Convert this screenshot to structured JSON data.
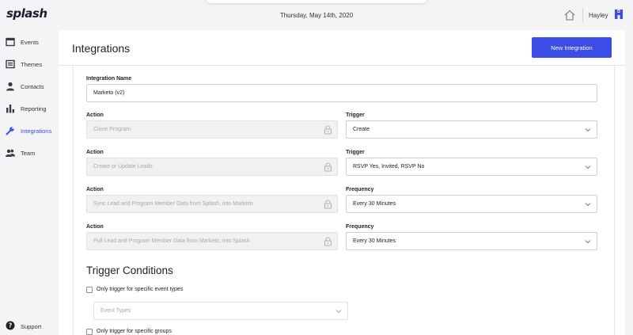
{
  "app": {
    "logo": "splash"
  },
  "header": {
    "date": "Thursday, May 14th, 2020",
    "user": "Hayley"
  },
  "sidebar": {
    "items": [
      {
        "label": "Events",
        "icon": "calendar-icon"
      },
      {
        "label": "Themes",
        "icon": "theme-icon"
      },
      {
        "label": "Contacts",
        "icon": "person-icon"
      },
      {
        "label": "Reporting",
        "icon": "bar-chart-icon"
      },
      {
        "label": "Integrations",
        "icon": "wrench-icon",
        "active": true
      },
      {
        "label": "Team",
        "icon": "team-icon"
      }
    ],
    "support": "Support"
  },
  "page": {
    "title": "Integrations",
    "new_button": "New Integration"
  },
  "form": {
    "integration_name_label": "Integration Name",
    "integration_name_value": "Marketo (v2)",
    "rows": [
      {
        "left_label": "Action",
        "left_value": "Clone Program",
        "right_label": "Trigger",
        "right_value": "Create"
      },
      {
        "left_label": "Action",
        "left_value": "Create or Update Leads",
        "right_label": "Trigger",
        "right_value": "RSVP Yes, Invited, RSVP No"
      },
      {
        "left_label": "Action",
        "left_value": "Sync Lead and Program Member Data from Splash, into Marketo",
        "right_label": "Frequency",
        "right_value": "Every 30 Minutes"
      },
      {
        "left_label": "Action",
        "left_value": "Pull Lead and Program Member Data from Marketo, into Splash",
        "right_label": "Frequency",
        "right_value": "Every 30 Minutes"
      }
    ]
  },
  "trigger_conditions": {
    "title": "Trigger Conditions",
    "event_types_checkbox": "Only trigger for specific event types",
    "event_types_placeholder": "Event Types",
    "groups_checkbox": "Only trigger for specific groups"
  },
  "colors": {
    "accent": "#3c4ce6",
    "active_nav": "#3a4de4"
  }
}
